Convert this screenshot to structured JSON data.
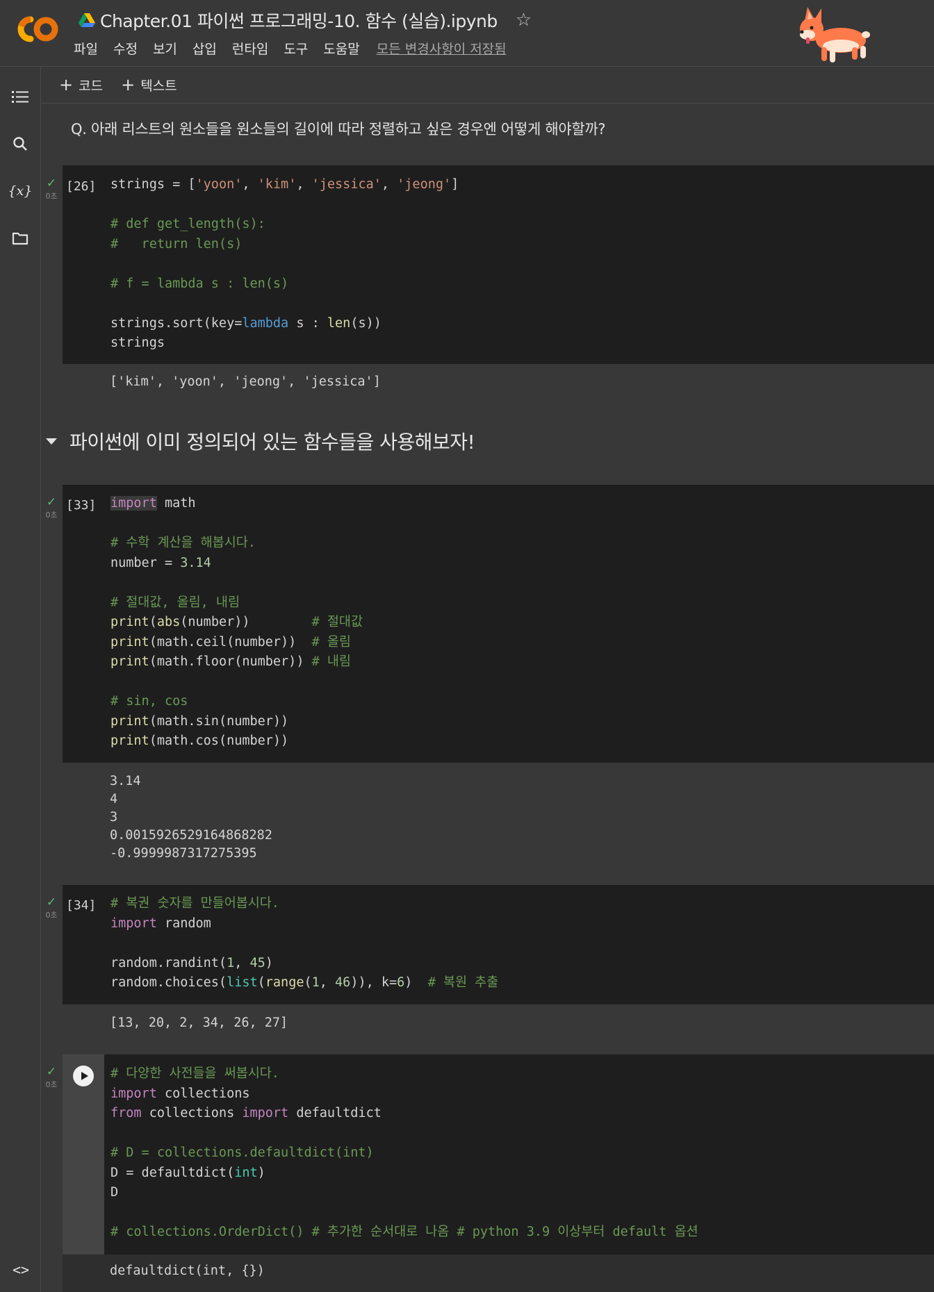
{
  "header": {
    "title": "Chapter.01 파이썬 프로그래밍-10. 함수 (실습).ipynb",
    "menu": [
      "파일",
      "수정",
      "보기",
      "삽입",
      "런타임",
      "도구",
      "도움말"
    ],
    "saved_status": "모든 변경사항이 저장됨",
    "logo_text": "CO"
  },
  "sidebar": {
    "items": [
      {
        "icon": "table-of-contents-icon"
      },
      {
        "icon": "search-icon"
      },
      {
        "icon": "variables-icon",
        "label": "{x}"
      },
      {
        "icon": "folder-icon"
      }
    ],
    "bottom_icon": "code-snippets-icon",
    "bottom_label": "<>"
  },
  "toolbar": {
    "add_code": "코드",
    "add_text": "텍스트"
  },
  "cells": {
    "question": "Q. 아래 리스트의 원소들을 원소들의 길이에 따라 정렬하고 싶은 경우엔 어떻게 해야할까?",
    "section_title": "파이썬에 이미 정의되어 있는 함수들을 사용해보자!",
    "exec_time": "0초",
    "cell26": {
      "count": "[26]",
      "output": "['kim', 'yoon', 'jeong', 'jessica']"
    },
    "cell33": {
      "count": "[33]",
      "output": "3.14\n4\n3\n0.0015926529164868282\n-0.9999987317275395"
    },
    "cell34": {
      "count": "[34]",
      "output": "[13, 20, 2, 34, 26, 27]"
    },
    "cell_last": {
      "output": "defaultdict(int, {})"
    }
  },
  "colors": {
    "background": "#383838",
    "code_bg": "#1e1e1e",
    "keyword": "#c586c0",
    "string": "#ce9178",
    "comment": "#6a9955",
    "success": "#5bb974",
    "logo_orange": "#f9ab00"
  }
}
